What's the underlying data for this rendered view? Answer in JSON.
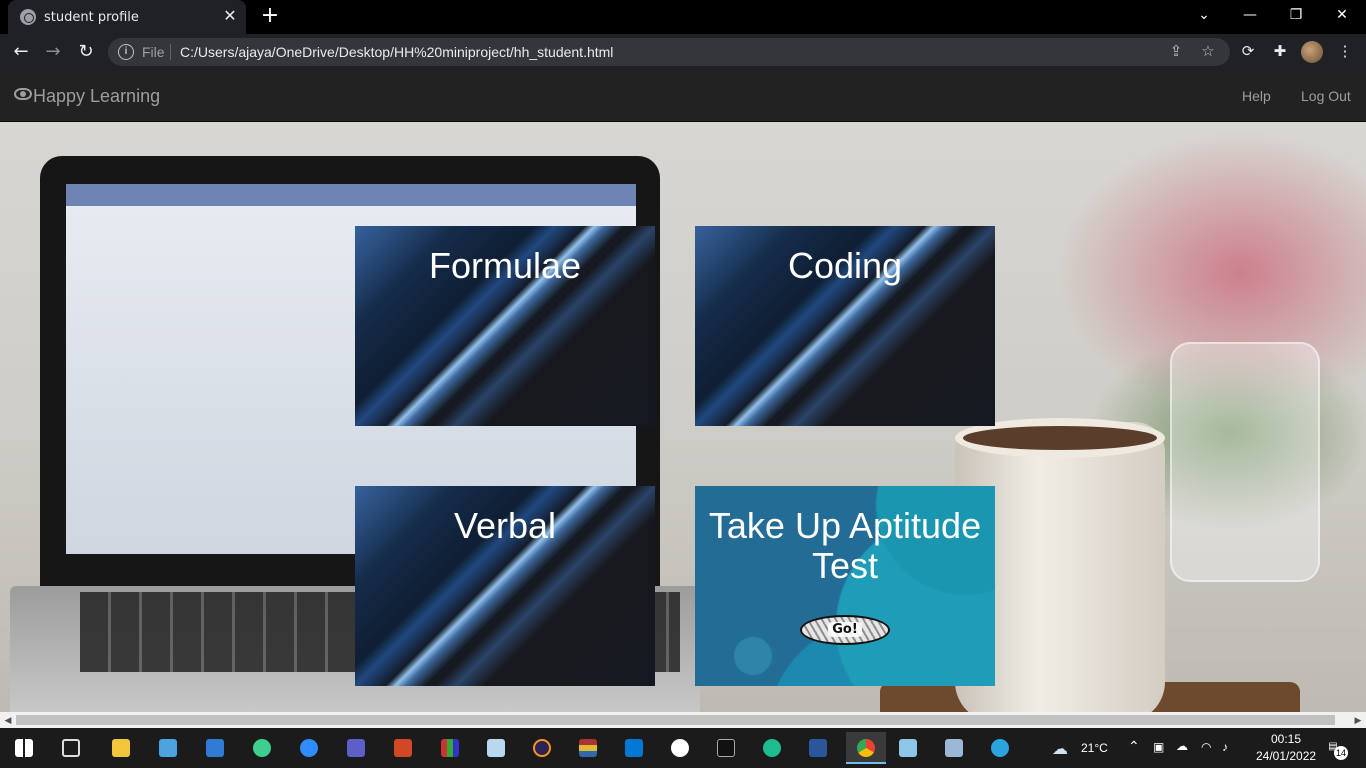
{
  "browser": {
    "tab_title": "student profile",
    "tab_close": "✕",
    "new_tab": "+",
    "window_controls": {
      "chevron": "⌄",
      "minimize": "—",
      "restore": "❐",
      "close": "✕"
    },
    "nav": {
      "back": "←",
      "forward": "→",
      "reload": "↻"
    },
    "address": {
      "info": "i",
      "scheme_label": "File",
      "url": "C:/Users/ajaya/OneDrive/Desktop/HH%20miniproject/hh_student.html"
    },
    "omnibox_icons": [
      "share-icon",
      "bookmark-star-icon"
    ],
    "toolbar_icons": [
      "extension-sync-icon",
      "extensions-puzzle-icon",
      "profile-avatar",
      "menu-kebab-icon"
    ],
    "menu_glyph": "⋮"
  },
  "site": {
    "brand": "Happy Learning",
    "nav_links": {
      "help": "Help",
      "logout": "Log Out"
    }
  },
  "cards": [
    {
      "title": "Formulae"
    },
    {
      "title": "Coding"
    },
    {
      "title": "Verbal"
    },
    {
      "title": "Take Up Aptitude Test",
      "button": "Go!"
    }
  ],
  "scrollbar": {
    "left_arrow": "◀",
    "right_arrow": "▶"
  },
  "taskbar": {
    "apps": [
      "start-icon",
      "task-view-icon",
      "file-explorer-icon",
      "this-pc-icon",
      "news-icon",
      "react-native-debugger-icon",
      "zoom-icon",
      "teams-icon",
      "powerpoint-icon",
      "winrar-icon",
      "paint-icon",
      "eclipse-icon",
      "archive-icon",
      "vscode-icon",
      "mongodb-compass-icon",
      "terminal-icon",
      "edge-icon",
      "word-icon",
      "chrome-icon",
      "notepad-icon",
      "virtualbox-icon",
      "telegram-icon"
    ],
    "weather": "21°C",
    "clock_time": "00:15",
    "clock_date": "24/01/2022",
    "notifications": "14"
  }
}
